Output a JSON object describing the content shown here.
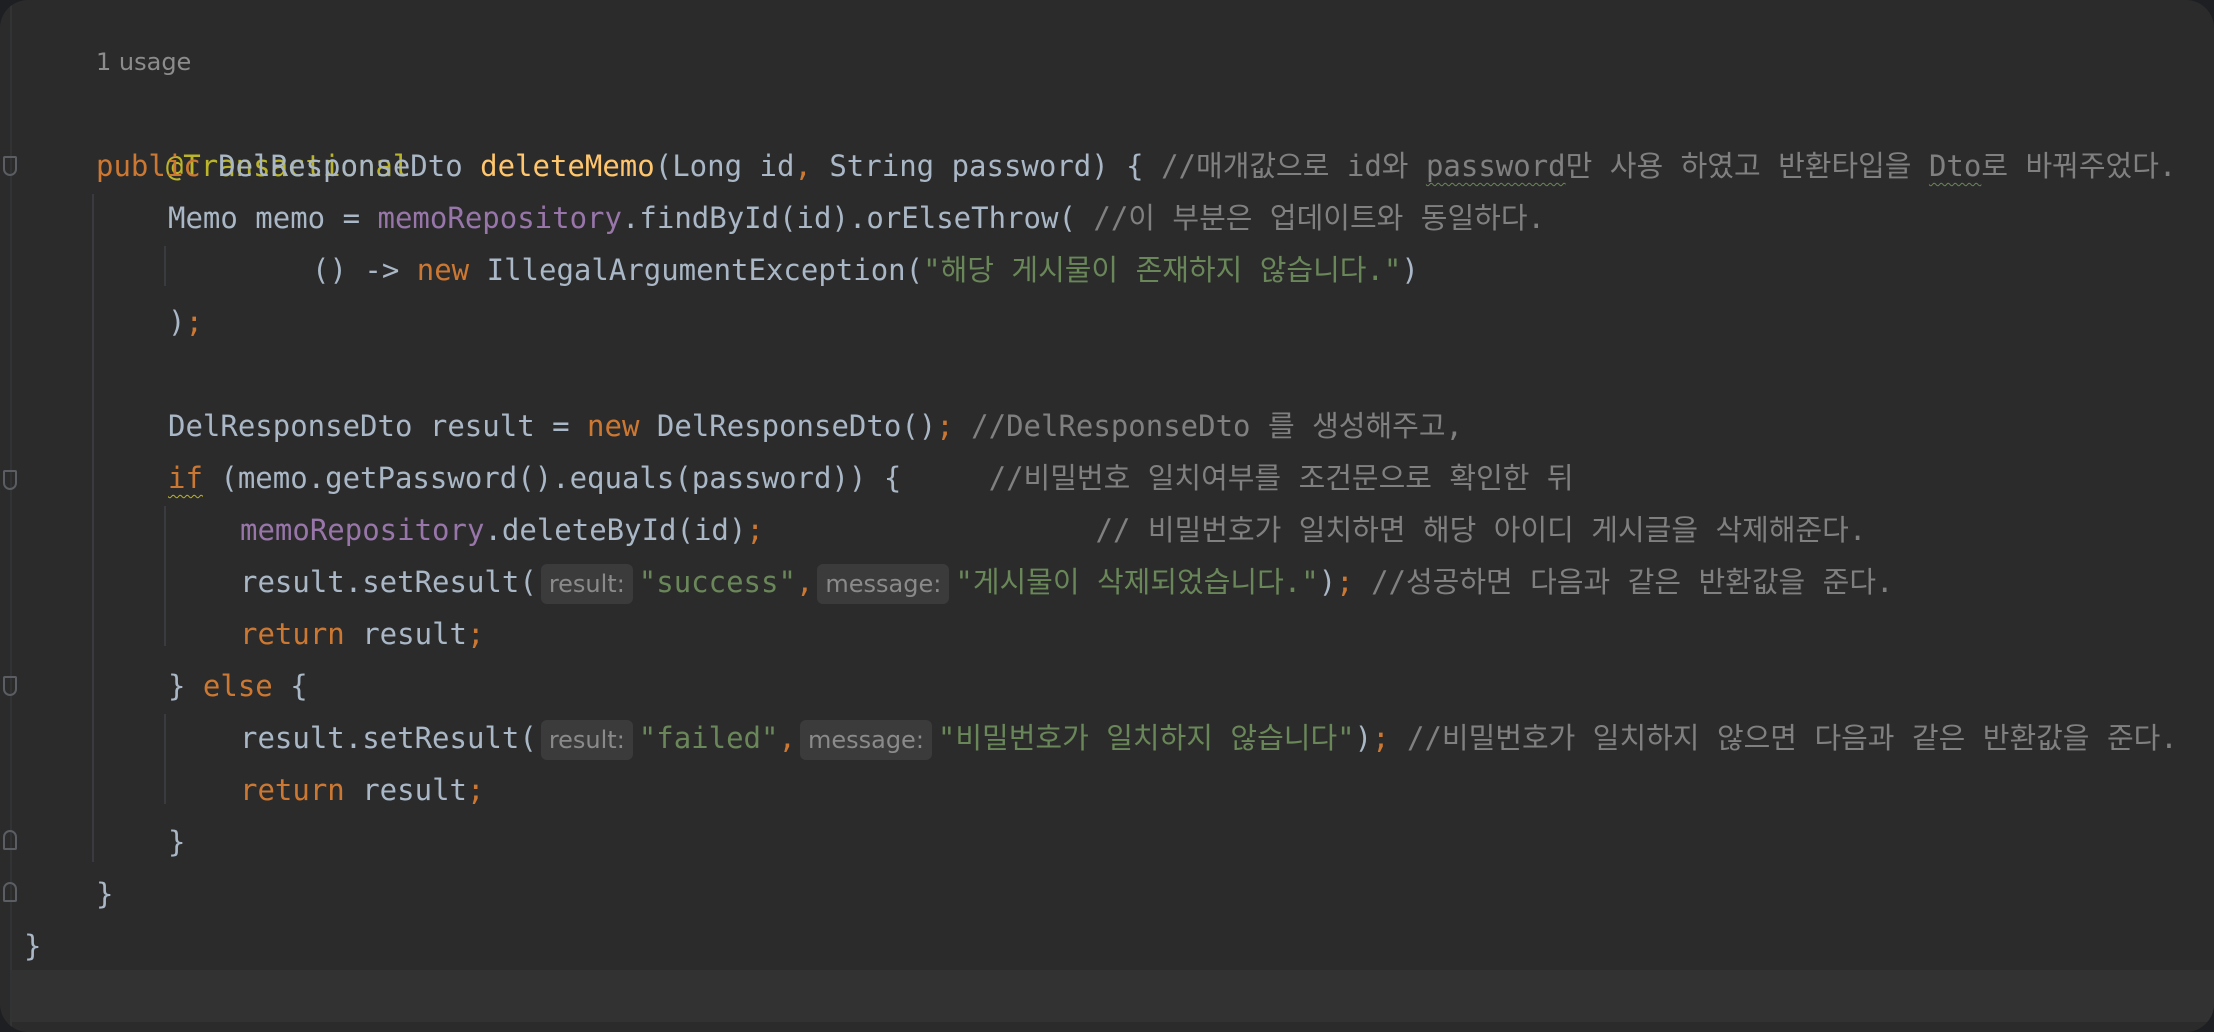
{
  "editor": {
    "usage": "1 usage",
    "annotation": "@Transactional",
    "l1": {
      "kw": "public",
      "type": " DelResponseDto ",
      "method": "deleteMemo",
      "params_a": "(Long id",
      "comma": ",",
      "params_b": " String password) { ",
      "comment_a": "//매개값으로 id와 ",
      "comment_pw": "password",
      "comment_b": "만 사용 하였고 반환타입을 ",
      "comment_dto": "Dto",
      "comment_c": "로 바꿔주었다."
    },
    "l2": {
      "a": "Memo memo = ",
      "field": "memoRepository",
      "b": ".findById(id).orElseThrow( ",
      "comment": "//이 부분은 업데이트와 동일하다."
    },
    "l3": {
      "a": "() -> ",
      "kw": "new",
      "b": " IllegalArgumentException(",
      "str": "\"해당 게시물이 존재하지 않습니다.\"",
      "c": ")"
    },
    "l4": {
      "a": ")",
      "semi": ";"
    },
    "l5": {
      "a": "DelResponseDto result = ",
      "kw": "new",
      "b": " DelResponseDto()",
      "semi": ";",
      "comment": " //DelResponseDto 를 생성해주고,"
    },
    "l6": {
      "kw": "if",
      "a": " (memo.getPassword().equals(password)) {     ",
      "comment": "//비밀번호 일치여부를 조건문으로 확인한 뒤"
    },
    "l7": {
      "field": "memoRepository",
      "a": ".deleteById(id)",
      "semi": ";",
      "spaces": "                   ",
      "comment": "// 비밀번호가 일치하면 해당 아이디 게시글을 삭제해준다."
    },
    "l8": {
      "a": "result.setResult(",
      "hint_result": "result:",
      "str1": "\"success\"",
      "comma": ",",
      "hint_message": "message:",
      "str2": "\"게시물이 삭제되었습니다.\"",
      "b": ")",
      "semi": ";",
      "comment": " //성공하면 다음과 같은 반환값을 준다."
    },
    "l9": {
      "kw": "return",
      "a": " result",
      "semi": ";"
    },
    "l10": {
      "a": "} ",
      "kw": "else",
      "b": " {"
    },
    "l11": {
      "a": "result.setResult(",
      "hint_result": "result:",
      "str1": "\"failed\"",
      "comma": ",",
      "hint_message": "message:",
      "str2": "\"비밀번호가 일치하지 않습니다\"",
      "b": ")",
      "semi": ";",
      "comment": " //비밀번호가 일치하지 않으면 다음과 같은 반환값을 준다."
    },
    "l12": {
      "kw": "return",
      "a": " result",
      "semi": ";"
    },
    "l13": "}",
    "l14": "}",
    "l15": "}"
  },
  "colors": {
    "background": "#2b2b2b",
    "keyword": "#cc7832",
    "annotation": "#bbb529",
    "method": "#ffc66d",
    "field": "#9876aa",
    "string": "#6a8759",
    "comment": "#808080",
    "text": "#a9b7c6"
  }
}
